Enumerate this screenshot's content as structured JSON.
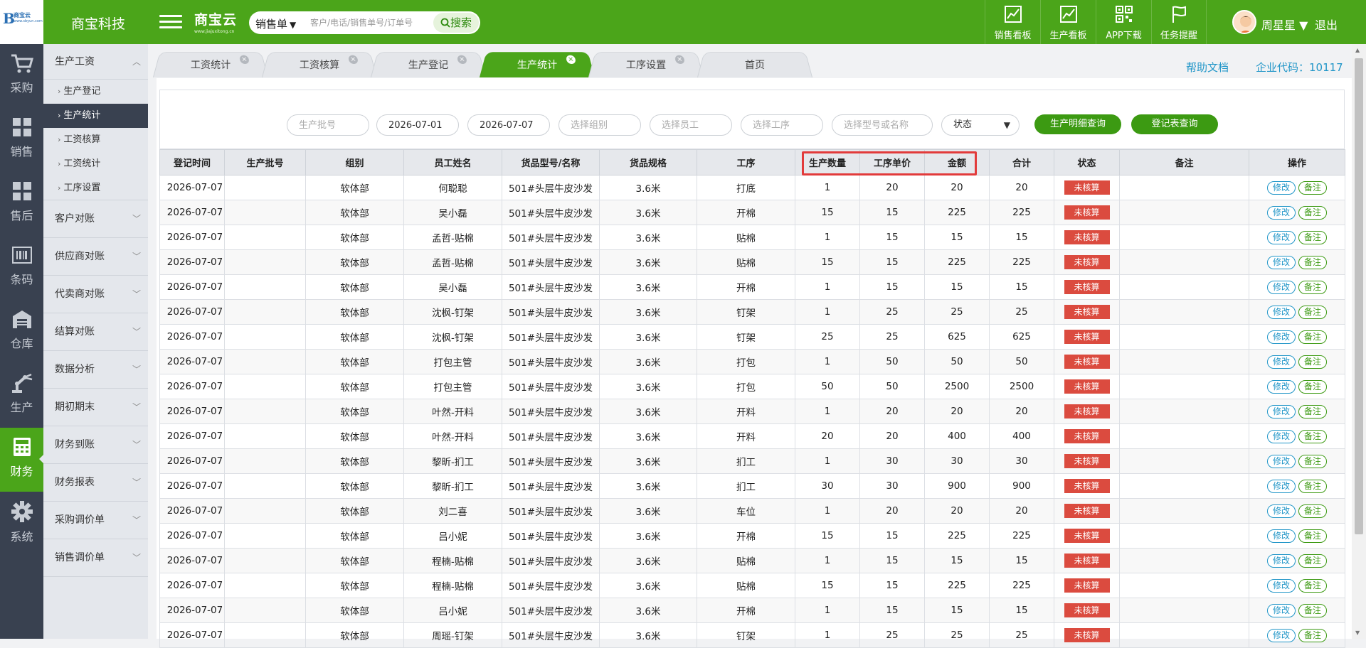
{
  "logo": {
    "mark": "B",
    "name": "商宝云",
    "sub": "www.sbyun.com"
  },
  "company": "商宝科技",
  "brand": {
    "title": "商宝云",
    "url": "www.jiajuxitong.cn"
  },
  "search": {
    "selector": "销售单",
    "placeholder": "客户/电话/销售单号/订单号",
    "button": "搜索"
  },
  "top_nav": [
    {
      "label": "销售看板",
      "icon": "chart-trend-icon"
    },
    {
      "label": "生产看板",
      "icon": "chart-trend-icon"
    },
    {
      "label": "APP下载",
      "icon": "qr-code-icon"
    },
    {
      "label": "任务提醒",
      "icon": "flag-icon"
    }
  ],
  "user": {
    "name": "周星星",
    "logout": "退出"
  },
  "icon_bar": [
    {
      "label": "采购",
      "icon": "cart-icon"
    },
    {
      "label": "销售",
      "icon": "grid-icon"
    },
    {
      "label": "售后",
      "icon": "grid-icon"
    },
    {
      "label": "条码",
      "icon": "barcode-icon"
    },
    {
      "label": "仓库",
      "icon": "warehouse-icon"
    },
    {
      "label": "生产",
      "icon": "robot-arm-icon"
    },
    {
      "label": "财务",
      "icon": "calculator-icon",
      "active": true
    },
    {
      "label": "系统",
      "icon": "gear-icon"
    }
  ],
  "menu": {
    "open_group": "生产工资",
    "sub_items": [
      "生产登记",
      "生产统计",
      "工资核算",
      "工资统计",
      "工序设置"
    ],
    "active_sub": "生产统计",
    "groups": [
      "客户对账",
      "供应商对账",
      "代卖商对账",
      "结算对账",
      "数据分析",
      "期初期末",
      "财务到账",
      "财务报表",
      "采购调价单",
      "销售调价单"
    ]
  },
  "tabs": [
    {
      "label": "工资统计"
    },
    {
      "label": "工资核算"
    },
    {
      "label": "生产登记"
    },
    {
      "label": "生产统计",
      "active": true
    },
    {
      "label": "工序设置"
    },
    {
      "label": "首页"
    }
  ],
  "help_link": "帮助文档",
  "company_code": "企业代码：10117",
  "filters": {
    "batch_placeholder": "生产批号",
    "date_from": "2026-07-01",
    "date_to": "2026-07-07",
    "group_placeholder": "选择组别",
    "employee_placeholder": "选择员工",
    "process_placeholder": "选择工序",
    "model_placeholder": "选择型号或名称",
    "status_label": "状态",
    "btn_detail": "生产明细查询",
    "btn_register": "登记表查询"
  },
  "table": {
    "columns": [
      "登记时间",
      "生产批号",
      "组别",
      "员工姓名",
      "货品型号/名称",
      "货品规格",
      "工序",
      "生产数量",
      "工序单价",
      "金额",
      "合计",
      "状态",
      "备注",
      "操作"
    ],
    "status_text": "未核算",
    "edit_label": "修改",
    "note_label": "备注",
    "rows": [
      [
        "2026-07-07",
        "",
        "软体部",
        "何聪聪",
        "501#头层牛皮沙发",
        "3.6米",
        "打底",
        "1",
        "20",
        "20",
        "20"
      ],
      [
        "2026-07-07",
        "",
        "软体部",
        "吴小磊",
        "501#头层牛皮沙发",
        "3.6米",
        "开棉",
        "15",
        "15",
        "225",
        "225"
      ],
      [
        "2026-07-07",
        "",
        "软体部",
        "孟哲-贴棉",
        "501#头层牛皮沙发",
        "3.6米",
        "贴棉",
        "1",
        "15",
        "15",
        "15"
      ],
      [
        "2026-07-07",
        "",
        "软体部",
        "孟哲-贴棉",
        "501#头层牛皮沙发",
        "3.6米",
        "贴棉",
        "15",
        "15",
        "225",
        "225"
      ],
      [
        "2026-07-07",
        "",
        "软体部",
        "吴小磊",
        "501#头层牛皮沙发",
        "3.6米",
        "开棉",
        "1",
        "15",
        "15",
        "15"
      ],
      [
        "2026-07-07",
        "",
        "软体部",
        "沈枫-钉架",
        "501#头层牛皮沙发",
        "3.6米",
        "钉架",
        "1",
        "25",
        "25",
        "25"
      ],
      [
        "2026-07-07",
        "",
        "软体部",
        "沈枫-钉架",
        "501#头层牛皮沙发",
        "3.6米",
        "钉架",
        "25",
        "25",
        "625",
        "625"
      ],
      [
        "2026-07-07",
        "",
        "软体部",
        "打包主管",
        "501#头层牛皮沙发",
        "3.6米",
        "打包",
        "1",
        "50",
        "50",
        "50"
      ],
      [
        "2026-07-07",
        "",
        "软体部",
        "打包主管",
        "501#头层牛皮沙发",
        "3.6米",
        "打包",
        "50",
        "50",
        "2500",
        "2500"
      ],
      [
        "2026-07-07",
        "",
        "软体部",
        "叶然-开料",
        "501#头层牛皮沙发",
        "3.6米",
        "开料",
        "1",
        "20",
        "20",
        "20"
      ],
      [
        "2026-07-07",
        "",
        "软体部",
        "叶然-开料",
        "501#头层牛皮沙发",
        "3.6米",
        "开料",
        "20",
        "20",
        "400",
        "400"
      ],
      [
        "2026-07-07",
        "",
        "软体部",
        "黎昕-扪工",
        "501#头层牛皮沙发",
        "3.6米",
        "扪工",
        "1",
        "30",
        "30",
        "30"
      ],
      [
        "2026-07-07",
        "",
        "软体部",
        "黎昕-扪工",
        "501#头层牛皮沙发",
        "3.6米",
        "扪工",
        "30",
        "30",
        "900",
        "900"
      ],
      [
        "2026-07-07",
        "",
        "软体部",
        "刘二喜",
        "501#头层牛皮沙发",
        "3.6米",
        "车位",
        "1",
        "20",
        "20",
        "20"
      ],
      [
        "2026-07-07",
        "",
        "软体部",
        "吕小妮",
        "501#头层牛皮沙发",
        "3.6米",
        "开棉",
        "15",
        "15",
        "225",
        "225"
      ],
      [
        "2026-07-07",
        "",
        "软体部",
        "程楠-贴棉",
        "501#头层牛皮沙发",
        "3.6米",
        "贴棉",
        "1",
        "15",
        "15",
        "15"
      ],
      [
        "2026-07-07",
        "",
        "软体部",
        "程楠-贴棉",
        "501#头层牛皮沙发",
        "3.6米",
        "贴棉",
        "15",
        "15",
        "225",
        "225"
      ],
      [
        "2026-07-07",
        "",
        "软体部",
        "吕小妮",
        "501#头层牛皮沙发",
        "3.6米",
        "开棉",
        "1",
        "15",
        "15",
        "15"
      ],
      [
        "2026-07-07",
        "",
        "软体部",
        "周瑶-钉架",
        "501#头层牛皮沙发",
        "3.6米",
        "钉架",
        "1",
        "25",
        "25",
        "25"
      ]
    ]
  },
  "colors": {
    "primary": "#4ba51a",
    "sidebar": "#394150",
    "badge": "#db4b3f",
    "link": "#2196c8",
    "highlight": "#e23b3b"
  }
}
